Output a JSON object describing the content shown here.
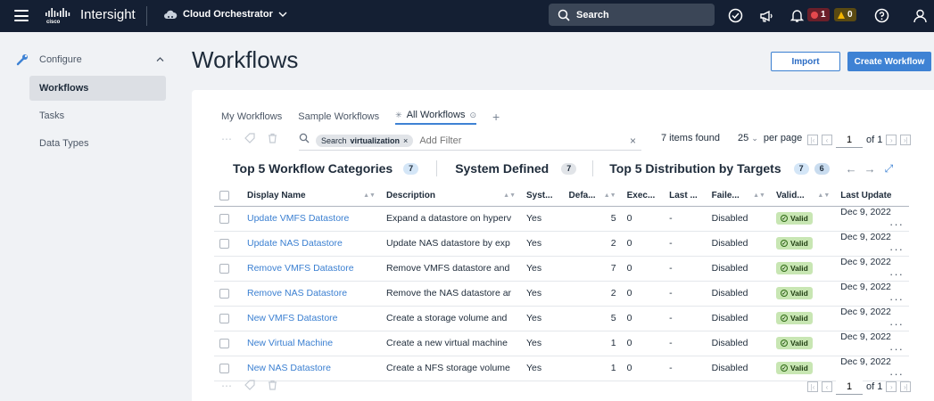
{
  "topbar": {
    "brand": "Intersight",
    "app_switcher": "Cloud Orchestrator",
    "search_label": "Search",
    "alerts_critical": "1",
    "alerts_warning": "0",
    "colors": {
      "bar": "#141f33",
      "critical": "#e5484d",
      "warning": "#f2b400"
    }
  },
  "sidebar": {
    "section": "Configure",
    "items": [
      {
        "label": "Workflows",
        "active": true
      },
      {
        "label": "Tasks",
        "active": false
      },
      {
        "label": "Data Types",
        "active": false
      }
    ]
  },
  "page": {
    "title": "Workflows",
    "import_label": "Import",
    "create_label": "Create Workflow"
  },
  "tabs": [
    {
      "label": "My Workflows"
    },
    {
      "label": "Sample Workflows"
    },
    {
      "label": "All Workflows"
    }
  ],
  "filter": {
    "chip_prefix": "Search",
    "chip_value": "virtualization",
    "placeholder": "Add Filter",
    "items_found": "7 items found",
    "per_page_value": "25",
    "per_page_label": "per page",
    "page": "1",
    "of_pages": "of 1"
  },
  "summary": {
    "categories_title": "Top 5 Workflow Categories",
    "categories_count": "7",
    "system_title": "System Defined",
    "system_count": "7",
    "targets_title": "Top 5 Distribution by Targets",
    "targets_count_a": "7",
    "targets_count_b": "6"
  },
  "table": {
    "columns": [
      "Display Name",
      "Description",
      "Syst...",
      "Defa...",
      "Exec...",
      "Last ...",
      "Faile...",
      "Valid...",
      "Last Update"
    ],
    "rows": [
      {
        "name": "Update VMFS Datastore",
        "desc": "Expand a datastore on hyperv",
        "system": "Yes",
        "default": "5",
        "exec": "0",
        "last": "-",
        "failed": "Disabled",
        "valid": "Valid",
        "update": "Dec 9, 2022"
      },
      {
        "name": "Update NAS Datastore",
        "desc": "Update NAS datastore by exp",
        "system": "Yes",
        "default": "2",
        "exec": "0",
        "last": "-",
        "failed": "Disabled",
        "valid": "Valid",
        "update": "Dec 9, 2022"
      },
      {
        "name": "Remove VMFS Datastore",
        "desc": "Remove VMFS datastore and",
        "system": "Yes",
        "default": "7",
        "exec": "0",
        "last": "-",
        "failed": "Disabled",
        "valid": "Valid",
        "update": "Dec 9, 2022"
      },
      {
        "name": "Remove NAS Datastore",
        "desc": "Remove the NAS datastore ar",
        "system": "Yes",
        "default": "2",
        "exec": "0",
        "last": "-",
        "failed": "Disabled",
        "valid": "Valid",
        "update": "Dec 9, 2022"
      },
      {
        "name": "New VMFS Datastore",
        "desc": "Create a storage volume and",
        "system": "Yes",
        "default": "5",
        "exec": "0",
        "last": "-",
        "failed": "Disabled",
        "valid": "Valid",
        "update": "Dec 9, 2022"
      },
      {
        "name": "New Virtual Machine",
        "desc": "Create a new virtual machine",
        "system": "Yes",
        "default": "1",
        "exec": "0",
        "last": "-",
        "failed": "Disabled",
        "valid": "Valid",
        "update": "Dec 9, 2022"
      },
      {
        "name": "New NAS Datastore",
        "desc": "Create a NFS storage volume",
        "system": "Yes",
        "default": "1",
        "exec": "0",
        "last": "-",
        "failed": "Disabled",
        "valid": "Valid",
        "update": "Dec 9, 2022"
      }
    ]
  },
  "footer": {
    "page": "1",
    "of_pages": "of 1"
  }
}
